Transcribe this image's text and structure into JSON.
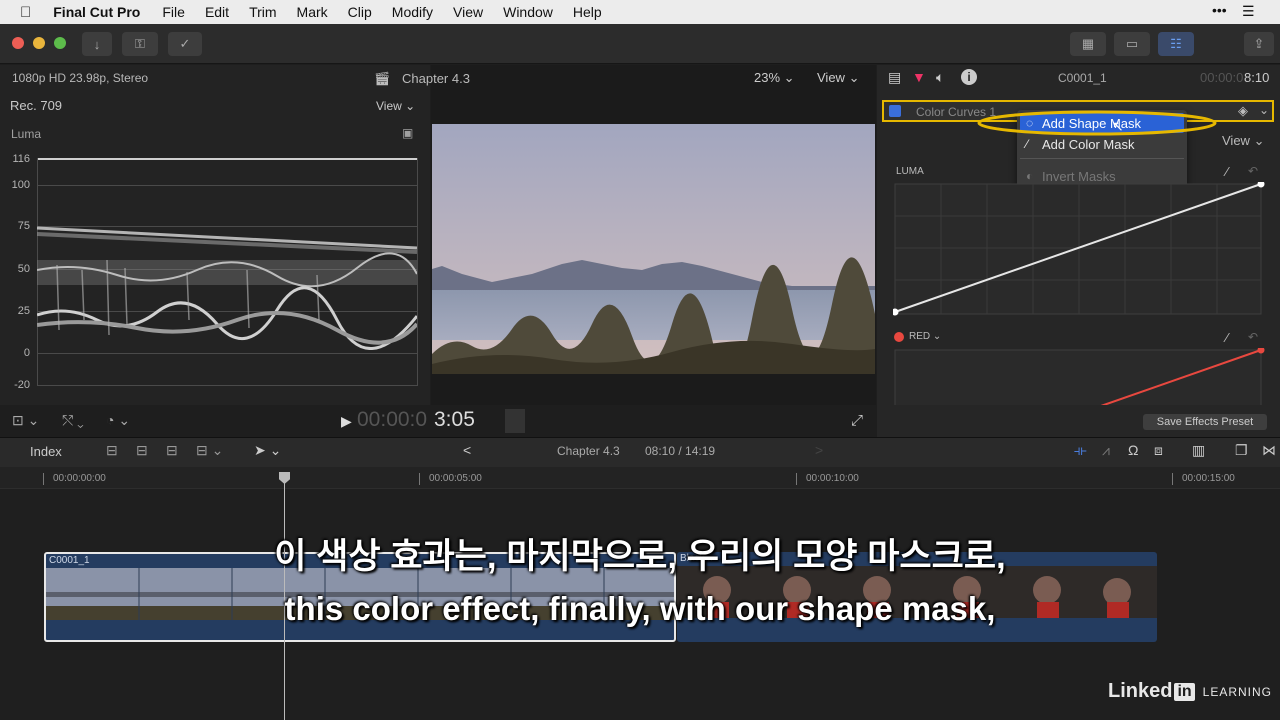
{
  "menubar": {
    "app_name": "Final Cut Pro",
    "items": [
      "File",
      "Edit",
      "Trim",
      "Mark",
      "Clip",
      "Modify",
      "View",
      "Window",
      "Help"
    ]
  },
  "viewer": {
    "format": "1080p HD 23.98p, Stereo",
    "title": "Chapter 4.3",
    "zoom": "23%",
    "view_label": "View",
    "timecode_dim": "00:00:0",
    "timecode": "3:05"
  },
  "scope": {
    "color_space": "Rec. 709",
    "view_label": "View",
    "type": "Luma",
    "scale": [
      "116",
      "100",
      "75",
      "50",
      "25",
      "0",
      "-20"
    ]
  },
  "inspector": {
    "clip_name": "C0001_1",
    "timecode_dim": "00:00:0",
    "timecode": "8:10",
    "effect_name": "Color Curves 1",
    "view_label": "View",
    "luma_label": "LUMA",
    "red_label": "RED",
    "save_preset": "Save Effects Preset"
  },
  "mask_menu": {
    "add_shape_mask": "Add Shape Mask",
    "add_color_mask": "Add Color Mask",
    "invert_masks": "Invert Masks"
  },
  "timeline": {
    "index_label": "Index",
    "project_name": "Chapter 4.3",
    "position": "08:10 / 14:19",
    "ruler": [
      "00:00:00:00",
      "00:00:05:00",
      "00:00:10:00",
      "00:00:15:00"
    ],
    "clip1_name": "C0001_1",
    "clip2_name": "Black..."
  },
  "subtitles": {
    "korean": "이 색상 효과는, 마지막으로, 우리의 모양 마스크로,",
    "english": "this color effect, finally, with our shape mask,"
  },
  "watermark": {
    "brand": "Linked",
    "in": "in",
    "learning": "LEARNING"
  },
  "colors": {
    "accent_blue": "#2a62d6",
    "highlight_yellow": "#e6b800",
    "curve_red": "#e8483f"
  }
}
